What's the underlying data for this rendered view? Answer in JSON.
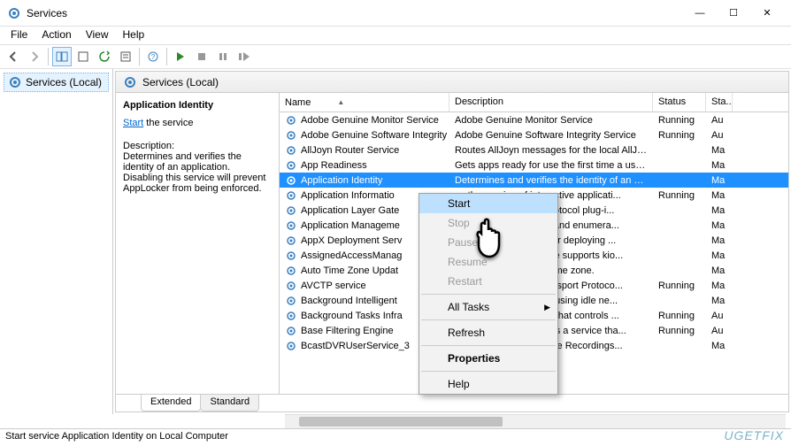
{
  "window": {
    "title": "Services",
    "minimize_glyph": "—",
    "maximize_glyph": "☐",
    "close_glyph": "✕"
  },
  "menu": [
    "File",
    "Action",
    "View",
    "Help"
  ],
  "tree": {
    "root": "Services (Local)"
  },
  "pane_header": "Services (Local)",
  "detail": {
    "selected_name": "Application Identity",
    "start_label": "Start",
    "start_suffix": "the service",
    "desc_label": "Description:",
    "desc_text": "Determines and verifies the identity of an application. Disabling this service will prevent AppLocker from being enforced."
  },
  "columns": {
    "name": "Name",
    "desc": "Description",
    "status": "Status",
    "startup": "Sta..."
  },
  "rows": [
    {
      "name": "Adobe Genuine Monitor Service",
      "desc": "Adobe Genuine Monitor Service",
      "status": "Running",
      "su": "Au"
    },
    {
      "name": "Adobe Genuine Software Integrity Servi...",
      "desc": "Adobe Genuine Software Integrity Service",
      "status": "Running",
      "su": "Au"
    },
    {
      "name": "AllJoyn Router Service",
      "desc": "Routes AllJoyn messages for the local AllJoyn...",
      "status": "",
      "su": "Ma"
    },
    {
      "name": "App Readiness",
      "desc": "Gets apps ready for use the first time a user si...",
      "status": "",
      "su": "Ma"
    },
    {
      "name": "Application Identity",
      "desc": "Determines and verifies the identity of an app...",
      "status": "",
      "su": "Ma",
      "sel": true
    },
    {
      "name": "Application Informatio",
      "desc": "              es the running of interactive applicati...",
      "status": "Running",
      "su": "Ma"
    },
    {
      "name": "Application Layer Gate",
      "desc": "               support for 3rd party protocol plug-i...",
      "status": "",
      "su": "Ma"
    },
    {
      "name": "Application Manageme",
      "desc": "              s installation, removal, and enumera...",
      "status": "",
      "su": "Ma"
    },
    {
      "name": "AppX Deployment Serv",
      "desc": "               infrastructure support for deploying ...",
      "status": "",
      "su": "Ma"
    },
    {
      "name": "AssignedAccessManag",
      "desc": "              AccessManager Service supports kio...",
      "status": "",
      "su": "Ma"
    },
    {
      "name": "Auto Time Zone Updat",
      "desc": "              ically sets the system time zone.",
      "status": "",
      "su": "Ma"
    },
    {
      "name": "AVCTP service",
      "desc": "               udio Video Control Transport Protoco...",
      "status": "Running",
      "su": "Ma"
    },
    {
      "name": "Background Intelligent",
      "desc": "               files in the background using idle ne...",
      "status": "",
      "su": "Ma"
    },
    {
      "name": "Background Tasks Infra",
      "desc": "              s infrastructure service that controls ...",
      "status": "Running",
      "su": "Au"
    },
    {
      "name": "Base Filtering Engine",
      "desc": "               Filtering Engine (BFE) is a service tha...",
      "status": "Running",
      "su": "Au"
    },
    {
      "name": "BcastDVRUserService_3",
      "desc": "              service is used for Game Recordings...",
      "status": "",
      "su": "Ma"
    }
  ],
  "context_menu": [
    {
      "label": "Start",
      "highlight": true
    },
    {
      "label": "Stop",
      "disabled": true
    },
    {
      "label": "Pause",
      "disabled": true
    },
    {
      "label": "Resume",
      "disabled": true
    },
    {
      "label": "Restart",
      "disabled": true
    },
    {
      "sep": true
    },
    {
      "label": "All Tasks",
      "arrow": true
    },
    {
      "sep": true
    },
    {
      "label": "Refresh"
    },
    {
      "sep": true
    },
    {
      "label": "Properties",
      "bold": true
    },
    {
      "sep": true
    },
    {
      "label": "Help"
    }
  ],
  "tabs": {
    "extended": "Extended",
    "standard": "Standard"
  },
  "statusbar": "Start service Application Identity on Local Computer",
  "watermark": "UGETFIX"
}
